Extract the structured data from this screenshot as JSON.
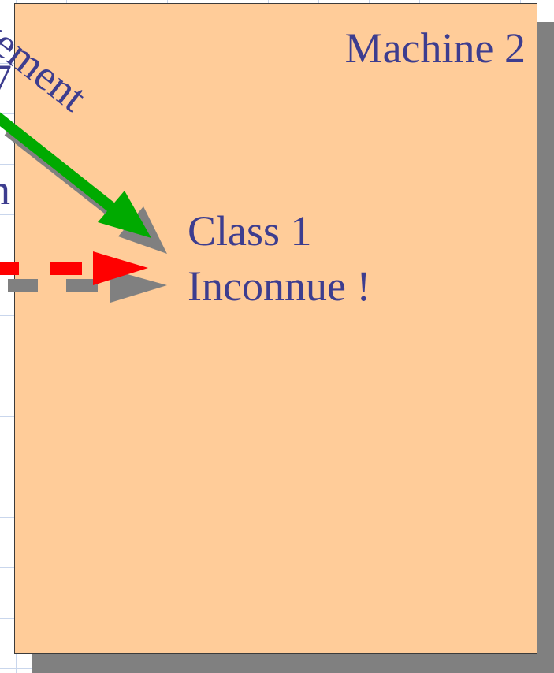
{
  "diagram": {
    "machine_title": "Machine 2",
    "class_label": "Class 1",
    "status_label": "Inconnue !",
    "cut_text_rotated": "gement",
    "cut_text_left_1": "7",
    "cut_text_left_2": "n",
    "colors": {
      "box_fill": "#ffcc99",
      "box_shadow": "#808080",
      "text": "#3d3d8f",
      "green_arrow": "#00aa00",
      "red_arrow": "#ff0000",
      "grid": "#c9d6ec"
    }
  }
}
